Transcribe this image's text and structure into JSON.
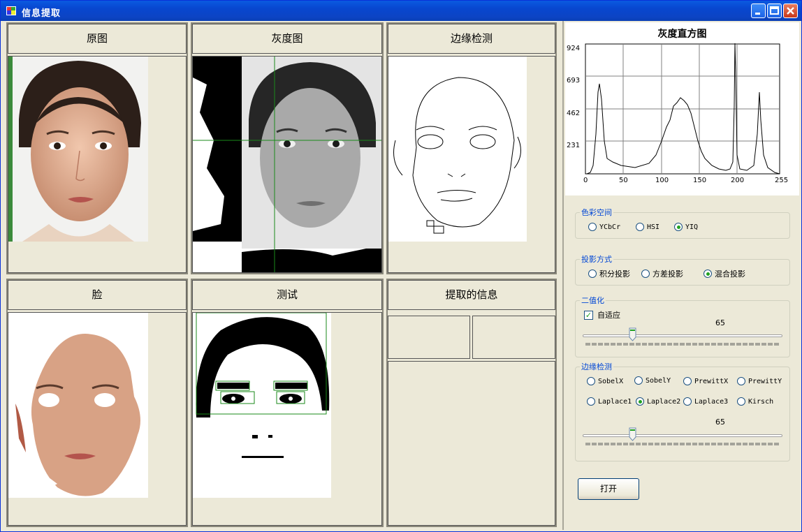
{
  "window": {
    "title": "信息提取",
    "controls": [
      "minimize",
      "maximize",
      "close"
    ]
  },
  "panels": {
    "original": "原图",
    "gray": "灰度图",
    "edge": "边缘检测",
    "face": "脸",
    "test": "测试",
    "extracted": "提取的信息"
  },
  "histogram": {
    "title": "灰度直方图",
    "y_ticks": [
      "924",
      "693",
      "462",
      "231"
    ],
    "x_ticks": [
      "0",
      "50",
      "100",
      "150",
      "200",
      "255"
    ]
  },
  "color_space": {
    "label": "色彩空间",
    "options": [
      "YCbCr",
      "HSI",
      "YIQ"
    ],
    "selected": "YIQ"
  },
  "projection": {
    "label": "投影方式",
    "options": [
      "积分投影",
      "方差投影",
      "混合投影"
    ],
    "selected": "混合投影"
  },
  "binarize": {
    "label": "二值化",
    "adaptive_label": "自适应",
    "adaptive_checked": true,
    "value": "65",
    "level": 0.25
  },
  "edge_detect": {
    "label": "边缘检测",
    "options": [
      "SobelX",
      "SobelY",
      "PrewittX",
      "PrewittY",
      "Laplace1",
      "Laplace2",
      "Laplace3",
      "Kirsch"
    ],
    "selected": "Laplace2",
    "value": "65",
    "level": 0.25
  },
  "open_button": "打开",
  "colors": {
    "title_bar": "#0a5ae0",
    "group_label": "#0046d5",
    "face_box": "#1a8a1a"
  }
}
